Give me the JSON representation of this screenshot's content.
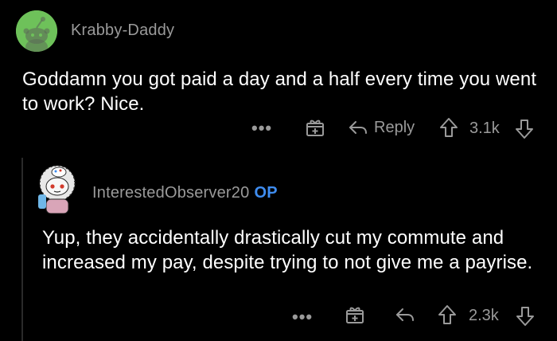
{
  "comment1": {
    "username": "Krabby-Daddy",
    "text": "Goddamn you got paid a day and a half every time you went to work? Nice.",
    "more_label": "•••",
    "reply_label": "Reply",
    "vote_count": "3.1k",
    "avatar_bg": "#6ec15a"
  },
  "comment2": {
    "username": "InterestedObserver20",
    "badge": "OP",
    "text": "Yup, they accidentally drastically cut my commute and increased my pay, despite trying to not give me a payrise.",
    "more_label": "•••",
    "vote_count": "2.3k"
  },
  "icons": {
    "gift": "gift-icon",
    "reply": "reply-arrow-icon",
    "upvote": "upvote-arrow-icon",
    "downvote": "downvote-arrow-icon",
    "more": "more-options-icon"
  },
  "colors": {
    "background": "#000000",
    "meta_text": "#9a9a9a",
    "body_text": "#ffffff",
    "op_badge": "#3f8df0"
  }
}
